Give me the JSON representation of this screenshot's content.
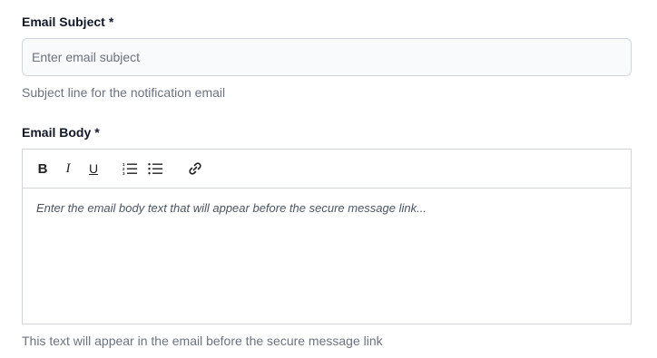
{
  "subject": {
    "label": "Email Subject",
    "required_mark": "*",
    "placeholder": "Enter email subject",
    "value": "",
    "help": "Subject line for the notification email"
  },
  "body": {
    "label": "Email Body",
    "required_mark": "*",
    "placeholder": "Enter the email body text that will appear before the secure message link...",
    "help": "This text will appear in the email before the secure message link",
    "toolbar": {
      "bold_icon": "bold-icon",
      "italic_icon": "italic-icon",
      "underline_icon": "underline-icon",
      "ordered_list_icon": "ordered-list-icon",
      "bullet_list_icon": "bullet-list-icon",
      "link_icon": "link-icon",
      "bold_glyph": "B",
      "italic_glyph": "I",
      "underline_glyph": "U"
    }
  },
  "colors": {
    "input_bg": "#f9fafb",
    "border": "#d1d5db",
    "help_text": "#6b7280"
  }
}
